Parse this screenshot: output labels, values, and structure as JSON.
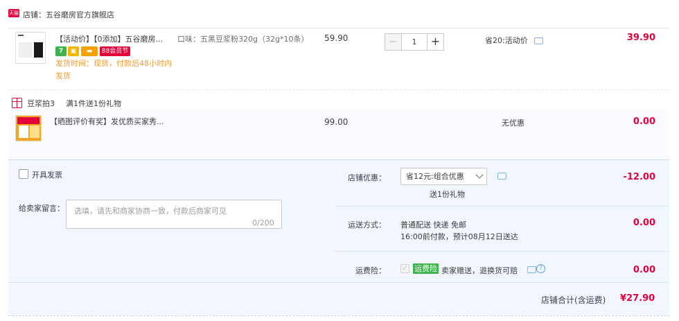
{
  "shop": {
    "logo_text": "天猫",
    "label": "店铺：五谷磨房官方旗舰店"
  },
  "item": {
    "title": "【活动价】【0添加】五谷磨房...",
    "badges": {
      "seven": "7",
      "eighty_eight": "88会员节"
    },
    "ship_time": "发货时间：现货，付款后48小时内发货",
    "flavor": "口味：五黑豆浆粉320g（32g*10条）",
    "price": "59.90",
    "quantity": "1",
    "promo": "省20:活动价",
    "total": "39.90"
  },
  "gift": {
    "label": "豆浆拍3",
    "rule": "满1件送1份礼物",
    "title": "【晒图评价有奖】发优质买家秀...",
    "price": "99.00",
    "discount": "无优惠",
    "total": "0.00"
  },
  "invoice": {
    "label": "开具发票"
  },
  "note": {
    "label": "给卖家留言：",
    "placeholder": "选填，请先和商家协商一致，付款后商家可见",
    "count": "0/200"
  },
  "store_discount": {
    "label": "店铺优惠：",
    "selected": "省12元:组合优惠",
    "sub": "送1份礼物",
    "value": "-12.00"
  },
  "shipping": {
    "label": "运送方式：",
    "line1": "普通配送 快递 免邮",
    "line2": "16:00前付款，预计08月12日送达",
    "value": "0.00"
  },
  "insurance": {
    "label": "运费险：",
    "badge": "运费险",
    "text": "卖家赠送，退换货可赔",
    "value": "0.00"
  },
  "summary": {
    "label": "店铺合计(含运费)",
    "value": "¥27.90"
  }
}
